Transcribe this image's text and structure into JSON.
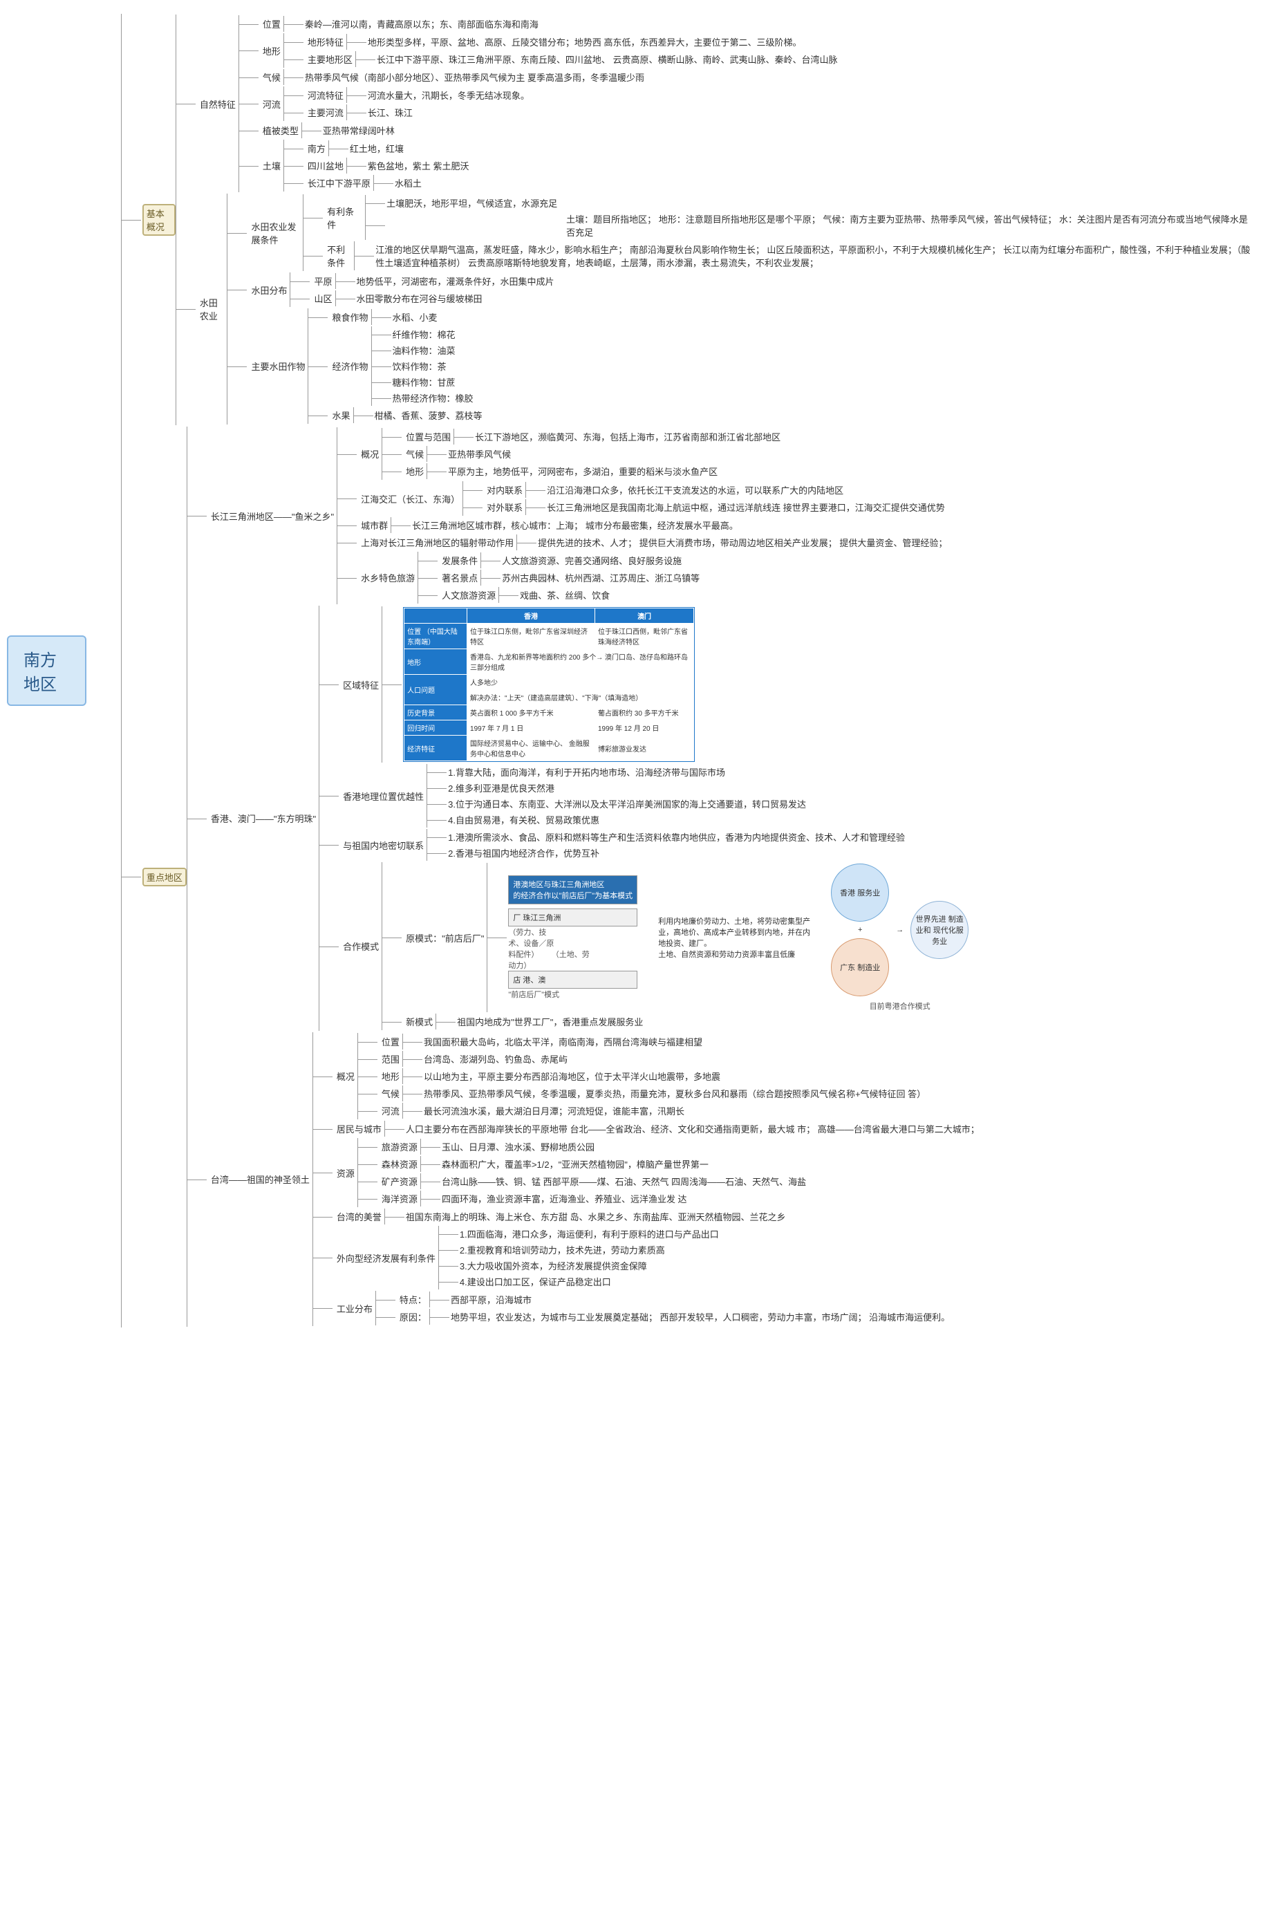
{
  "root": "南方地区",
  "s1": {
    "title": "基本概况",
    "nat": {
      "t": "自然特征",
      "pos": {
        "k": "位置",
        "v": "秦岭—淮河以南，青藏高原以东；东、南部面临东海和南海"
      },
      "terrain": {
        "k": "地形",
        "feat": {
          "k": "地形特征",
          "v": "地形类型多样，平原、盆地、高原、丘陵交错分布；地势西\n高东低，东西差异大，主要位于第二、三级阶梯。"
        },
        "main": {
          "k": "主要地形区",
          "v": "长江中下游平原、珠江三角洲平原、东南丘陵、四川盆地、\n云贵高原、横断山脉、南岭、武夷山脉、秦岭、台湾山脉"
        }
      },
      "climate": {
        "k": "气候",
        "v": "热带季风气候（南部小部分地区）、亚热带季风气候为主      夏季高温多雨，冬季温暖少雨"
      },
      "river": {
        "k": "河流",
        "rfeat": {
          "k": "河流特征",
          "v": "河流水量大，汛期长，冬季无结冰现象。"
        },
        "rmain": {
          "k": "主要河流",
          "v": "长江、珠江"
        }
      },
      "veg": {
        "k": "植被类型",
        "v": "亚热带常绿阔叶林"
      },
      "soil": {
        "k": "土壤",
        "a": {
          "k": "南方",
          "v": "红土地，红壤"
        },
        "b": {
          "k": "四川盆地",
          "v": "紫色盆地，紫土      紫土肥沃"
        },
        "c": {
          "k": "长江中下游平原",
          "v": "水稻土"
        }
      }
    },
    "paddy_tips": "土壤：题目所指地区；\n地形：注意题目所指地形区是哪个平原；\n气候：南方主要为亚热带、热带季风气候，答出气候特征；\n水：关注图片是否有河流分布或当地气候降水是否充足",
    "paddy": {
      "t": "水田农业",
      "cond": {
        "k": "水田农业发展条件",
        "fav": {
          "k": "有利条件",
          "v": "土壤肥沃，地形平坦，气候适宜，水源充足"
        },
        "unfav": {
          "k": "不利条件",
          "v": "江淮的地区伏旱期气温高，蒸发旺盛，降水少，影响水稻生产；\n南部沿海夏秋台风影响作物生长；\n山区丘陵面积达，平原面积小，不利于大规模机械化生产；\n长江以南为红壤分布面积广，酸性强，不利于种植业发展；（酸性土壤适宜种植茶树）\n云贵高原喀斯特地貌发育，地表崎岖，土层薄，雨水渗漏，表土易流失，不利农业发展；"
        }
      },
      "dist": {
        "k": "水田分布",
        "p": {
          "k": "平原",
          "v": "地势低平，河湖密布，灌溉条件好，水田集中成片"
        },
        "m": {
          "k": "山区",
          "v": "水田零散分布在河谷与缓坡梯田"
        }
      },
      "crops": {
        "k": "主要水田作物",
        "g": {
          "k": "粮食作物",
          "v": "水稻、小麦"
        },
        "e": {
          "k": "经济作物",
          "v1": "纤维作物：棉花",
          "v2": "油料作物：油菜",
          "v3": "饮料作物：茶",
          "v4": "糖料作物：甘蔗",
          "v5": "热带经济作物：橡胶"
        },
        "f": {
          "k": "水果",
          "v": "柑橘、香蕉、菠萝、荔枝等"
        }
      }
    }
  },
  "s2": {
    "title": "重点地区",
    "yrd": {
      "t": "长江三角洲地区——\"鱼米之乡\"",
      "ov": {
        "k": "概况",
        "a": {
          "k": "位置与范围",
          "v": "长江下游地区，濒临黄河、东海，包括上海市，江苏省南部和浙江省北部地区"
        },
        "b": {
          "k": "气候",
          "v": "亚热带季风气候"
        },
        "c": {
          "k": "地形",
          "v": "平原为主，地势低平，河网密布，多湖泊，重要的稻米与淡水鱼产区"
        }
      },
      "jh": {
        "k": "江海交汇（长江、东海）",
        "in": {
          "k": "对内联系",
          "v": "沿江沿海港口众多，依托长江干支流发达的水运，可以联系广大的内陆地区"
        },
        "out": {
          "k": "对外联系",
          "v": "长江三角洲地区是我国南北海上航运中枢，通过远洋航线连\n接世界主要港口，江海交汇提供交通优势"
        }
      },
      "city": {
        "k": "城市群",
        "v": "长江三角洲地区城市群，核心城市：上海；\n城市分布最密集，经济发展水平最高。"
      },
      "sh": {
        "k": "上海对长江三角洲地区的辐射带动作用",
        "v": "提供先进的技术、人才；\n提供巨大消费市场，带动周边地区相关产业发展；\n提供大量资金、管理经验；"
      },
      "tour": {
        "k": "水乡特色旅游",
        "a": {
          "k": "发展条件",
          "v": "人文旅游资源、完善交通网络、良好服务设施"
        },
        "b": {
          "k": "著名景点",
          "v": "苏州古典园林、杭州西湖、江苏周庄、浙江乌镇等"
        },
        "c": {
          "k": "人文旅游资源",
          "v": "戏曲、茶、丝绸、饮食"
        }
      }
    },
    "hk": {
      "t": "香港、澳门——\"东方明珠\"",
      "reg": {
        "k": "区域特征",
        "table": {
          "h1": "香港",
          "h2": "澳门",
          "r1k": "位置\n（中国大陆东南端）",
          "r1a": "位于珠江口东侧，毗邻广东省深圳经济特区",
          "r1b": "位于珠江口西侧，毗邻广东省珠海经济特区",
          "r2k": "地形",
          "r2v": "香港岛、九龙和新界等地面积约 200 多个→      澳门口岛、氹仔岛和路环岛三部分组成",
          "r3k": "人口问题",
          "r3v": "人多地少",
          "r3s": "解决办法：\"上天\"（建造高层建筑）、\"下海\"（填海造地）",
          "r4k": "历史背景",
          "r4a": "英占面积 1 000 多平方千米",
          "r4b": "葡占面积约 30 多平方千米",
          "r5k": "回归时间",
          "r5a": "1997 年 7 月 1 日",
          "r5b": "1999 年 12 月 20 日",
          "r6k": "经济特征",
          "r6a": "国际经济贸易中心、运输中心、\n金融服务中心和信息中心",
          "r6b": "博彩旅游业发达"
        }
      },
      "adv": {
        "k": "香港地理位置优越性",
        "l1": "1.背靠大陆，面向海洋，有利于开拓内地市场、沿海经济带与国际市场",
        "l2": "2.维多利亚港是优良天然港",
        "l3": "3.位于沟通日本、东南亚、大洋洲以及太平洋沿岸美洲国家的海上交通要道，转口贸易发达",
        "l4": "4.自由贸易港，有关税、贸易政策优惠"
      },
      "rel": {
        "k": "与祖国内地密切联系",
        "l1": "1.港澳所需淡水、食品、原料和燃料等生产和生活资料依靠内地供应，香港为内地提供资金、技术、人才和管理经验",
        "l2": "2.香港与祖国内地经济合作，优势互补"
      },
      "mode": {
        "k": "合作模式",
        "old": {
          "k": "原模式：\"前店后厂\"",
          "desc": "利用内地廉价劳动力、土地，将劳动密集型产\n业，高地价、高成本产业转移到内地，并在内\n地投资、建厂。\n土地、自然资源和劳动力资源丰富且低廉",
          "box_top": "港澳地区与珠江三角洲地区\n的经济合作以\"前店后厂\"为基本模式",
          "fac": "厂   珠江三角洲",
          "fac_sub": "（劳力、技\n术、设备／原\n料配件）      （土地、劳\n动力）",
          "store": "店   港、澳",
          "cap": "\"前店后厂\"模式"
        },
        "new": {
          "k": "新模式",
          "v": "祖国内地成为\"世界工厂\"，香港重点发展服务业",
          "c1": "香港\n服务业",
          "c2": "广东\n制造业",
          "c3": "世界先进\n制造业和\n现代化服\n务业",
          "cap": "目前粤港合作模式"
        }
      }
    },
    "tw": {
      "t": "台湾——祖国的神圣领土",
      "ov": {
        "k": "概况",
        "a": {
          "k": "位置",
          "v": "我国面积最大岛屿，北临太平洋，南临南海，西隔台湾海峡与福建相望"
        },
        "b": {
          "k": "范围",
          "v": "台湾岛、澎湖列岛、钓鱼岛、赤尾屿"
        },
        "c": {
          "k": "地形",
          "v": "以山地为主，平原主要分布西部沿海地区，位于太平洋火山地震带，多地震"
        },
        "d": {
          "k": "气候",
          "v": "热带季风、亚热带季风气候，冬季温暖，夏季炎热，雨量充沛，夏秋多台风和暴雨（综合题按照季风气候名称+气候特征回\n答）"
        },
        "e": {
          "k": "河流",
          "v": "最长河流浊水溪，最大湖泊日月潭；河流短促，谁能丰富，汛期长"
        }
      },
      "pop": {
        "k": "居民与城市",
        "v": "人口主要分布在西部海岸狭长的平原地带\n台北——全省政治、经济、文化和交通指南更新，最大城\n市；\n高雄——台湾省最大港口与第二大城市；"
      },
      "res": {
        "k": "资源",
        "a": {
          "k": "旅游资源",
          "v": "玉山、日月潭、浊水溪、野柳地质公园"
        },
        "b": {
          "k": "森林资源",
          "v": "森林面积广大，覆盖率>1/2，\"亚洲天然植物园\"，樟脑产量世界第一"
        },
        "c": {
          "k": "矿产资源",
          "v": "台湾山脉——铁、铜、锰\n西部平原——煤、石油、天然气\n四周浅海——石油、天然气、海盐"
        },
        "d": {
          "k": "海洋资源",
          "v": "四面环海，渔业资源丰富，近海渔业、养殖业、远洋渔业发\n达"
        }
      },
      "fame": {
        "k": "台湾的美誉",
        "v": "祖国东南海上的明珠、海上米仓、东方甜\n岛、水果之乡、东南盐库、亚洲天然植物园、兰花之乡"
      },
      "ext": {
        "k": "外向型经济发展有利条件",
        "l1": "1.四面临海，港口众多，海运便利，有利于原料的进口与产品出口",
        "l2": "2.重视教育和培训劳动力，技术先进，劳动力素质高",
        "l3": "3.大力吸收国外资本，为经济发展提供资金保障",
        "l4": "4.建设出口加工区，保证产品稳定出口"
      },
      "ind": {
        "k": "工业分布",
        "a": {
          "k": "特点：",
          "v": "西部平原，沿海城市"
        },
        "b": {
          "k": "原因：",
          "v": "地势平坦，农业发达，为城市与工业发展奠定基础；\n西部开发较早，人口稠密，劳动力丰富，市场广阔；\n沿海城市海运便利。"
        }
      }
    }
  }
}
